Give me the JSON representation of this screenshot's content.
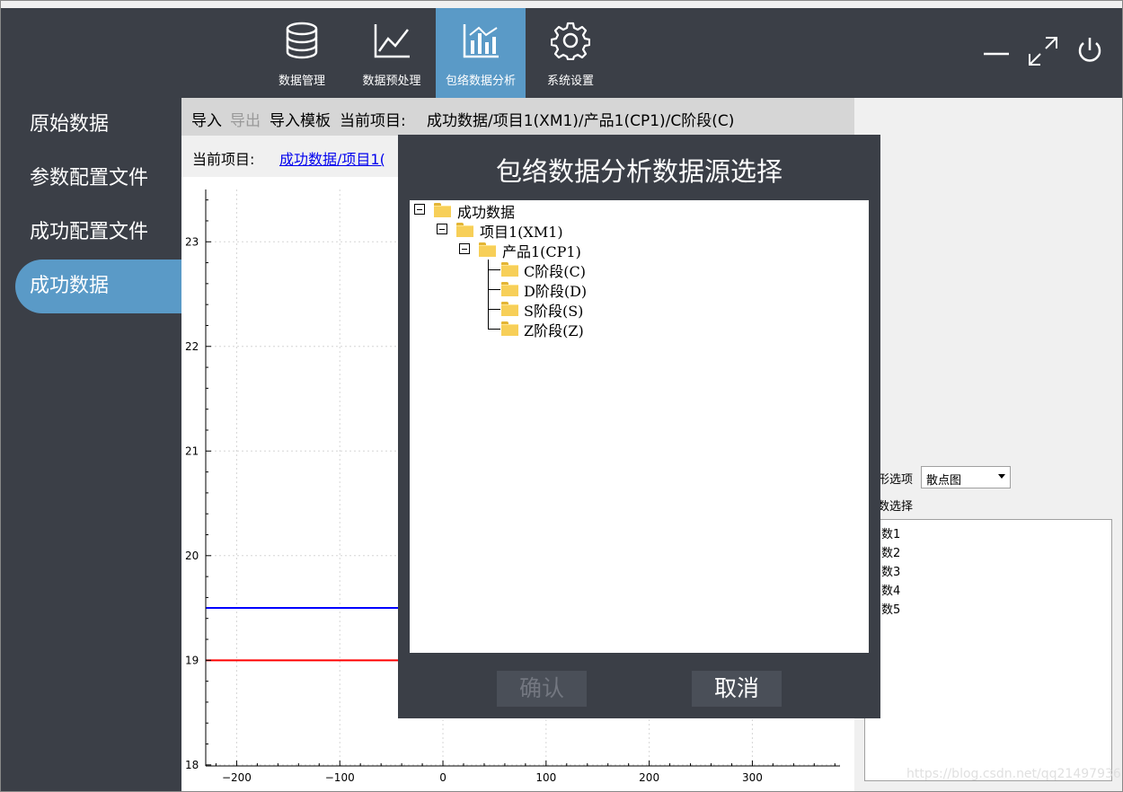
{
  "nav": {
    "items": [
      {
        "label": "数据管理",
        "icon": "database-icon",
        "active": false
      },
      {
        "label": "数据预处理",
        "icon": "line-chart-icon",
        "active": false
      },
      {
        "label": "包络数据分析",
        "icon": "bar-chart-icon",
        "active": true
      },
      {
        "label": "系统设置",
        "icon": "gear-icon",
        "active": false
      }
    ]
  },
  "window_controls": [
    "minimize-icon",
    "maximize-icon",
    "power-icon"
  ],
  "sidebar": {
    "items": [
      {
        "label": "原始数据",
        "active": false
      },
      {
        "label": "参数配置文件",
        "active": false
      },
      {
        "label": "成功配置文件",
        "active": false
      },
      {
        "label": "成功数据",
        "active": true
      }
    ]
  },
  "toolbar": {
    "import": "导入",
    "export": "导出",
    "import_template": "导入模板",
    "current_label": "当前项目:",
    "current_path": "成功数据/项目1(XM1)/产品1(CP1)/C阶段(C)"
  },
  "project_bar": {
    "label": "当前项目:",
    "link": "成功数据/项目1("
  },
  "chart_data": {
    "type": "line",
    "x_ticks": [
      -200,
      -100,
      0,
      100,
      200,
      300
    ],
    "y_ticks": [
      18,
      19,
      20,
      21,
      22,
      23
    ],
    "xlim": [
      -230,
      385
    ],
    "ylim": [
      17.99,
      23.5
    ],
    "grid": true,
    "series": [
      {
        "color": "#0000ff",
        "y": 19.5,
        "x_range": [
          -230,
          385
        ]
      },
      {
        "color": "#ff0000",
        "y": 19,
        "x_range": [
          -230,
          385
        ]
      }
    ]
  },
  "right_panel": {
    "graph_option_label": "形选项",
    "graph_option_value": "散点图",
    "param_label": "数选择",
    "params": [
      "数1",
      "数2",
      "数3",
      "数4",
      "数5"
    ],
    "watermark": "https://blog.csdn.net/qq21497936"
  },
  "dialog": {
    "title": "包络数据分析数据源选择",
    "tree": {
      "root": "成功数据",
      "project": "项目1(XM1)",
      "product": "产品1(CP1)",
      "stages": [
        "C阶段(C)",
        "D阶段(D)",
        "S阶段(S)",
        "Z阶段(Z)"
      ]
    },
    "confirm": "确认",
    "cancel": "取消"
  },
  "colors": {
    "dark": "#3b3f47",
    "accent": "#5a9ac7",
    "series_blue": "#0000ff",
    "series_red": "#ff0000"
  }
}
